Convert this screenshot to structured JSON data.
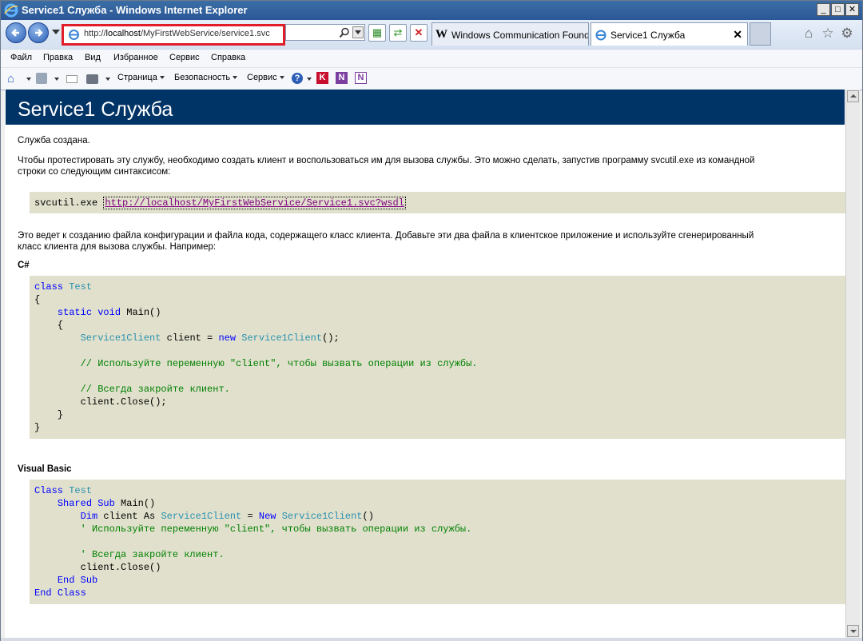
{
  "window": {
    "title": "Service1 Служба - Windows Internet Explorer",
    "controls": {
      "minimize": "_",
      "maximize": "□",
      "close": "✕"
    }
  },
  "addressbar": {
    "url_prefix": "http://",
    "url_host": "localhost",
    "url_path": "/MyFirstWebService/service1.svc",
    "highlight_color": "#e11d2a"
  },
  "tabs": [
    {
      "label": "Windows Communication Found...",
      "icon": "wikipedia-icon"
    },
    {
      "label": "Service1 Служба",
      "icon": "ie-page-icon",
      "active": true,
      "close": "✕"
    }
  ],
  "menu": [
    "Файл",
    "Правка",
    "Вид",
    "Избранное",
    "Сервис",
    "Справка"
  ],
  "commandbar": {
    "page": "Страница",
    "safety": "Безопасность",
    "tools": "Сервис"
  },
  "page": {
    "heading": "Service1 Служба",
    "heading_bg": "#003366",
    "created": "Служба создана.",
    "intro_line1": "Чтобы протестировать эту службу, необходимо создать клиент и воспользоваться им для вызова службы. Это можно сделать, запустив программу svcutil.exe из командной",
    "intro_line2": "строки со следующим синтаксисом:",
    "svcutil_cmd": "svcutil.exe ",
    "wsdl_link": "http://localhost/MyFirstWebService/Service1.svc?wsdl",
    "explain_line1": "Это ведет к созданию файла конфигурации и файла кода, содержащего класс клиента. Добавьте эти два файла в клиентское приложение и используйте сгенерированный",
    "explain_line2": "класс клиента для вызова службы. Например:",
    "csharp_title": "C#",
    "vb_title": "Visual Basic",
    "code_bg": "#e0e0cc",
    "comment_use": "Используйте переменную \"client\", чтобы вызвать операции из службы.",
    "comment_close": "Всегда закройте клиент."
  }
}
